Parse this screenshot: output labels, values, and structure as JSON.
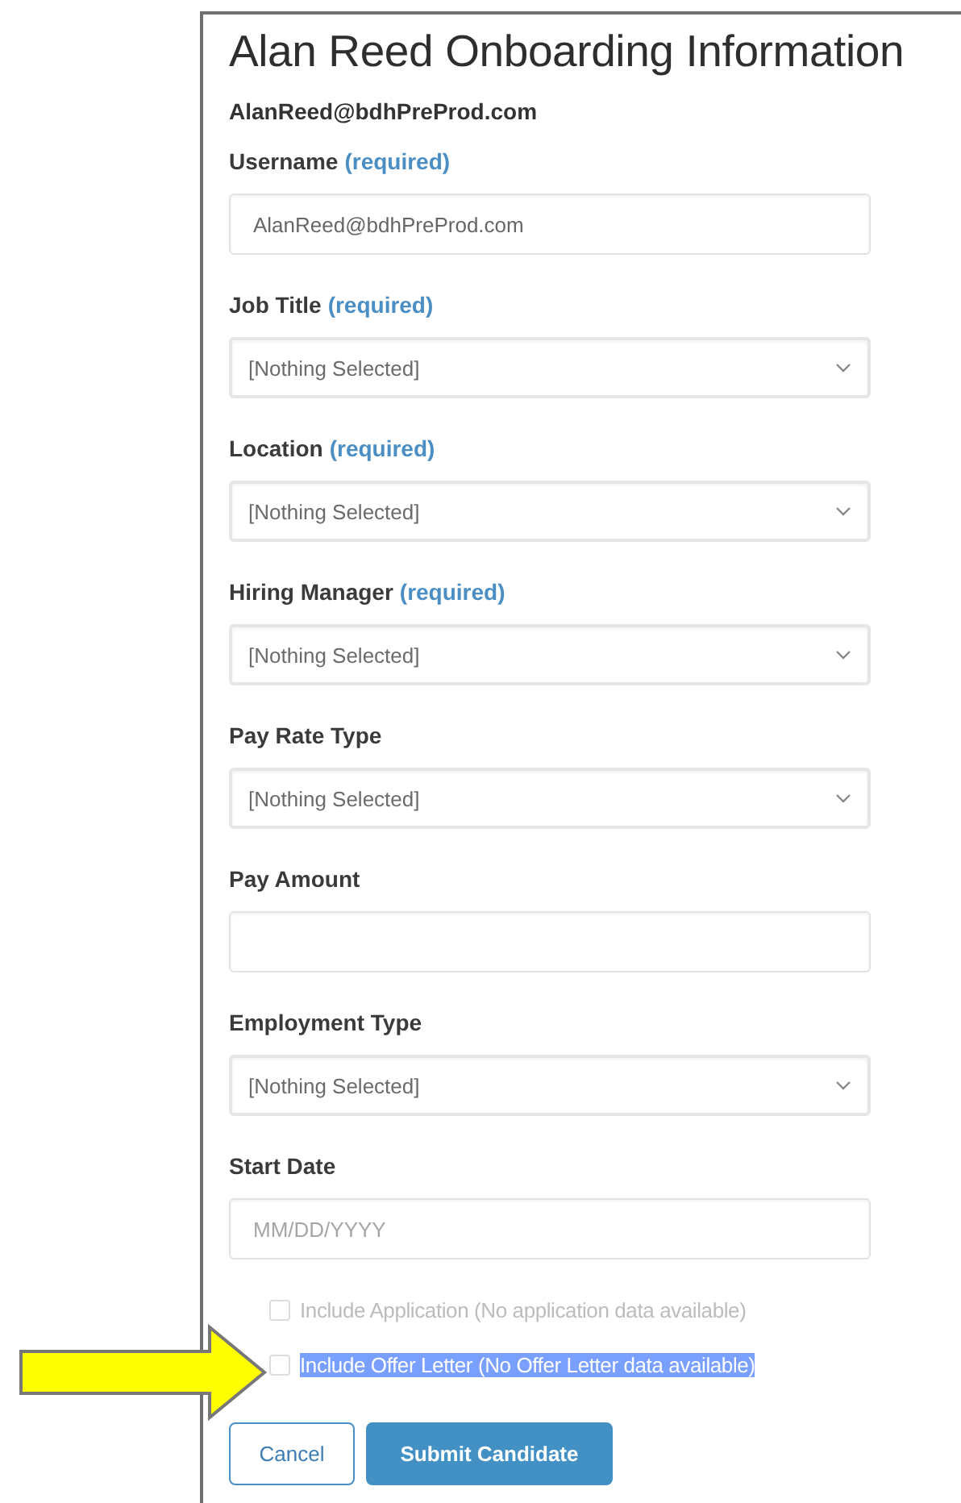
{
  "title": "Alan Reed Onboarding Information",
  "email": "AlanReed@bdhPreProd.com",
  "fields": [
    {
      "label": "Username",
      "required": "(required)",
      "kind": "text",
      "value": "AlanReed@bdhPreProd.com"
    },
    {
      "label": "Job Title",
      "required": "(required)",
      "kind": "select",
      "value": "[Nothing Selected]"
    },
    {
      "label": "Location",
      "required": "(required)",
      "kind": "select",
      "value": "[Nothing Selected]"
    },
    {
      "label": "Hiring Manager",
      "required": "(required)",
      "kind": "select",
      "value": "[Nothing Selected]"
    },
    {
      "label": "Pay Rate Type",
      "kind": "select",
      "value": "[Nothing Selected]"
    },
    {
      "label": "Pay Amount",
      "kind": "text"
    },
    {
      "label": "Employment Type",
      "kind": "select",
      "value": "[Nothing Selected]"
    },
    {
      "label": "Start Date",
      "kind": "text",
      "placeholder": "MM/DD/YYYY"
    }
  ],
  "options": [
    {
      "label": "Include Application (No application data available)",
      "checked": false,
      "disabled": true,
      "highlighted": false
    },
    {
      "label": "Include Offer Letter (No Offer Letter data available)",
      "checked": false,
      "disabled": false,
      "highlighted": true
    }
  ],
  "buttons": [
    {
      "label": "Cancel",
      "kind": "secondary"
    },
    {
      "label": "Submit Candidate",
      "kind": "primary"
    }
  ]
}
